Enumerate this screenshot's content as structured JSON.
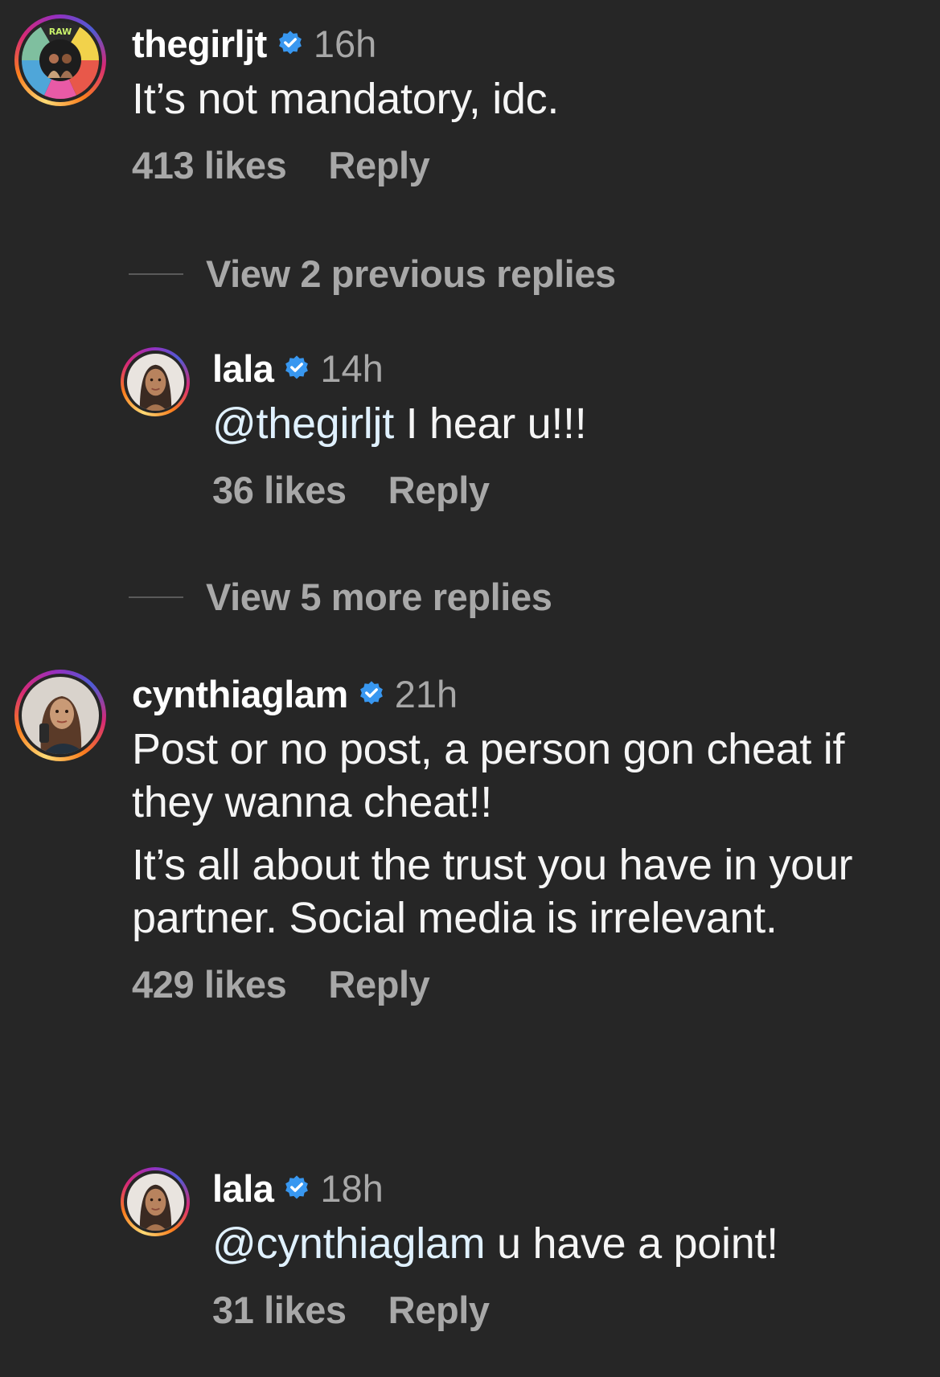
{
  "theme": {
    "background": "#262626",
    "secondary_text": "#a8a8a8",
    "mention_color": "#e0f1ff",
    "verified_color": "#3897f0"
  },
  "comments": [
    {
      "username": "thegirljt",
      "verified": true,
      "time": "16h",
      "text_lines": [
        "It’s not mandatory, idc."
      ],
      "likes": "413 likes",
      "reply_label": "Reply",
      "avatar_icon": "group-photo-avatar"
    },
    {
      "username": "cynthiaglam",
      "verified": true,
      "time": "21h",
      "paragraphs": [
        "Post or no post, a person gon cheat if they wanna cheat!!",
        "It’s all about the trust you have in your partner. Social media is irrelevant."
      ],
      "likes": "429 likes",
      "reply_label": "Reply",
      "avatar_icon": "woman-portrait-avatar"
    }
  ],
  "replies": [
    {
      "username": "lala",
      "verified": true,
      "time": "14h",
      "mention": "@thegirljt",
      "text": " I hear u!!!",
      "likes": "36 likes",
      "reply_label": "Reply",
      "avatar_icon": "woman-portrait-avatar"
    },
    {
      "username": "lala",
      "verified": true,
      "time": "18h",
      "mention": "@cynthiaglam",
      "text": " u have a point!",
      "likes": "31 likes",
      "reply_label": "Reply",
      "avatar_icon": "woman-portrait-avatar"
    }
  ],
  "view_previous": "View 2 previous replies",
  "view_more": "View 5 more replies"
}
